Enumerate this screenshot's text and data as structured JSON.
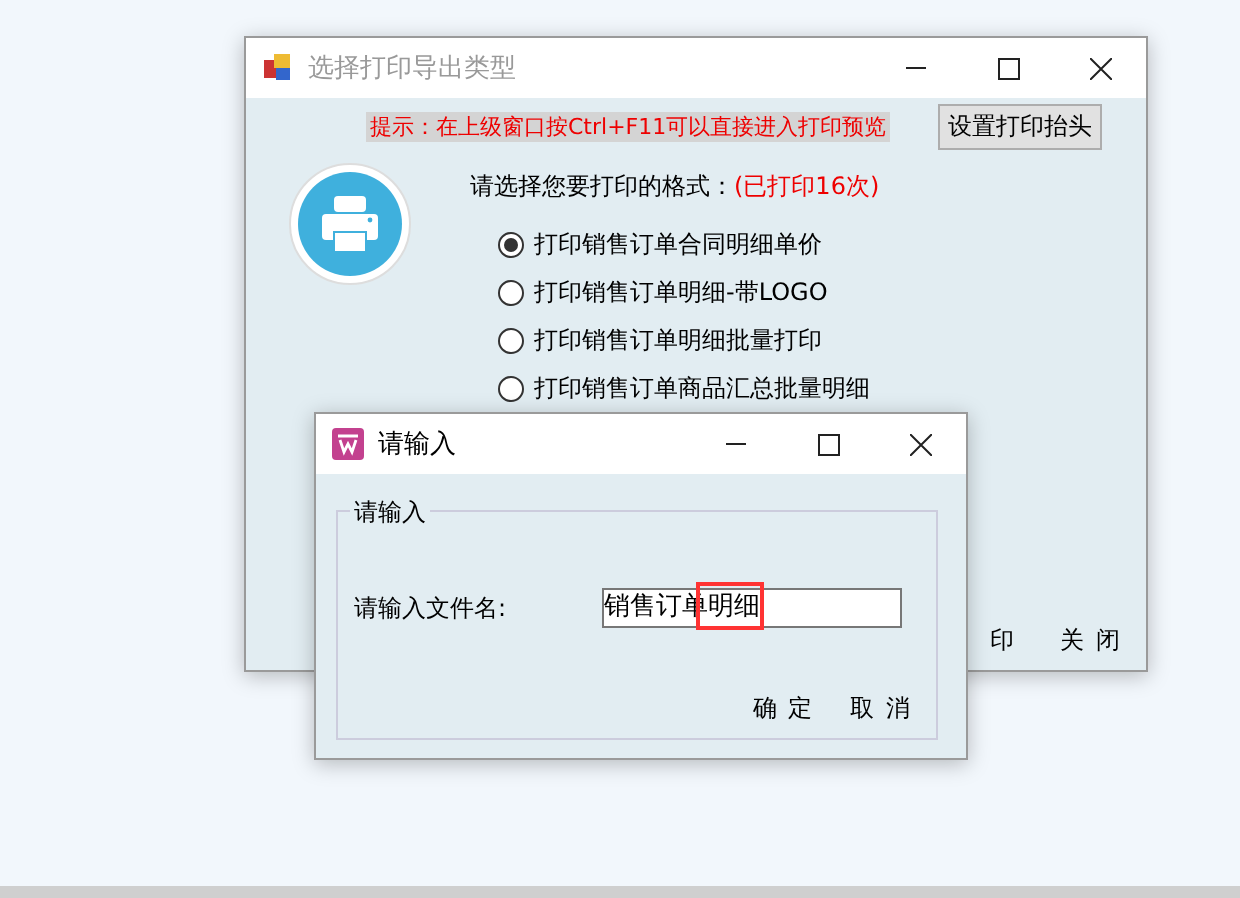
{
  "back_window": {
    "title": "选择打印导出类型",
    "hint": "提示：在上级窗口按Ctrl+F11可以直接进入打印预览",
    "header_button": "设置打印抬头",
    "prompt": "请选择您要打印的格式：",
    "print_count": "(已打印16次)",
    "options": [
      {
        "label": "打印销售订单合同明细单价",
        "selected": true
      },
      {
        "label": "打印销售订单明细-带LOGO",
        "selected": false
      },
      {
        "label": "打印销售订单明细批量打印",
        "selected": false
      },
      {
        "label": "打印销售订单商品汇总批量明细",
        "selected": false
      }
    ],
    "buttons": [
      "印",
      "关 闭"
    ]
  },
  "dialog": {
    "title": "请输入",
    "group_label": "请输入",
    "field_label": "请输入文件名:",
    "field_value": "销售订单明细",
    "buttons": [
      "确 定",
      "取 消"
    ]
  }
}
